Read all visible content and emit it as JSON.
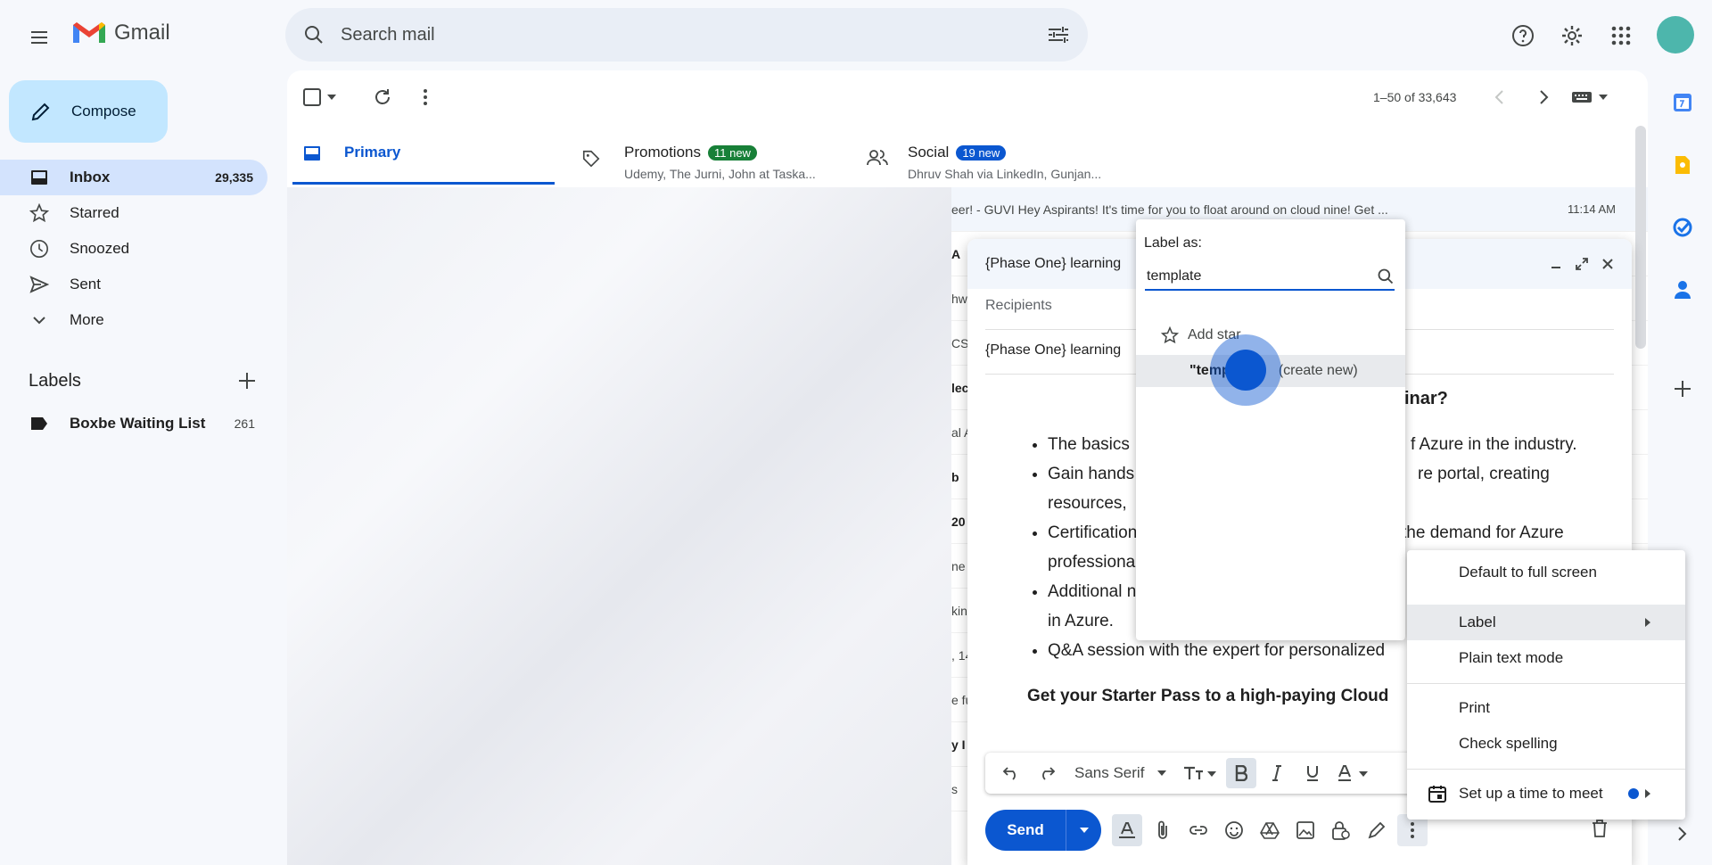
{
  "app": {
    "name": "Gmail"
  },
  "search": {
    "placeholder": "Search mail"
  },
  "nav": {
    "compose_label": "Compose",
    "items": [
      {
        "label": "Inbox",
        "count": "29,335"
      },
      {
        "label": "Starred",
        "count": ""
      },
      {
        "label": "Snoozed",
        "count": ""
      },
      {
        "label": "Sent",
        "count": ""
      },
      {
        "label": "More",
        "count": ""
      }
    ],
    "labels_heading": "Labels",
    "labels": [
      {
        "label": "Boxbe Waiting List",
        "count": "261"
      }
    ]
  },
  "toolbar": {
    "pagination": "1–50 of 33,643"
  },
  "tabs": [
    {
      "label": "Primary",
      "badge": "",
      "preview": ""
    },
    {
      "label": "Promotions",
      "badge": "11 new",
      "preview": "Udemy, The Jurni, John at Taska..."
    },
    {
      "label": "Social",
      "badge": "19 new",
      "preview": "Dhruv Shah via LinkedIn, Gunjan..."
    }
  ],
  "email_rows": {
    "first_snippet": "eer! - GUVI Hey Aspirants! It's time for you to float around on cloud nine! Get ...",
    "first_time": "11:14 AM",
    "partials": [
      "A",
      "hw",
      "CS,",
      "lec",
      "al A",
      "b",
      "20",
      "ne",
      "kin",
      ", 14",
      "e fu",
      "y I",
      "s"
    ]
  },
  "compose": {
    "subject": "{Phase One} learning",
    "recipients_placeholder": "Recipients",
    "subject_line": "{Phase One} learning",
    "heading_fragment": "inar?",
    "bullets": [
      "The basics",
      "Gain hands",
      "resources,",
      "Certification",
      "professiona",
      "Additional n",
      "in Azure.",
      "Q&A session with the expert for personalized"
    ],
    "bullet_tails": [
      "f Azure in the industry.",
      "re portal, creating",
      "the demand for Azure"
    ],
    "starter_line": "Get your Starter Pass to a high-paying Cloud",
    "font_name": "Sans Serif",
    "send_label": "Send"
  },
  "label_popup": {
    "title": "Label as:",
    "input_value": "template",
    "add_star": "Add star",
    "create_new_prefix": "\"temp",
    "create_new_suffix": "(create new)"
  },
  "more_menu": {
    "items": [
      "Default to full screen",
      "Label",
      "Plain text mode",
      "Print",
      "Check spelling",
      "Set up a time to meet"
    ]
  },
  "colors": {
    "compose_bg": "#c2e7ff",
    "active_nav": "#d3e3fd",
    "primary_blue": "#0b57d0",
    "promotions_badge": "#188038",
    "social_badge": "#0b57d0"
  }
}
